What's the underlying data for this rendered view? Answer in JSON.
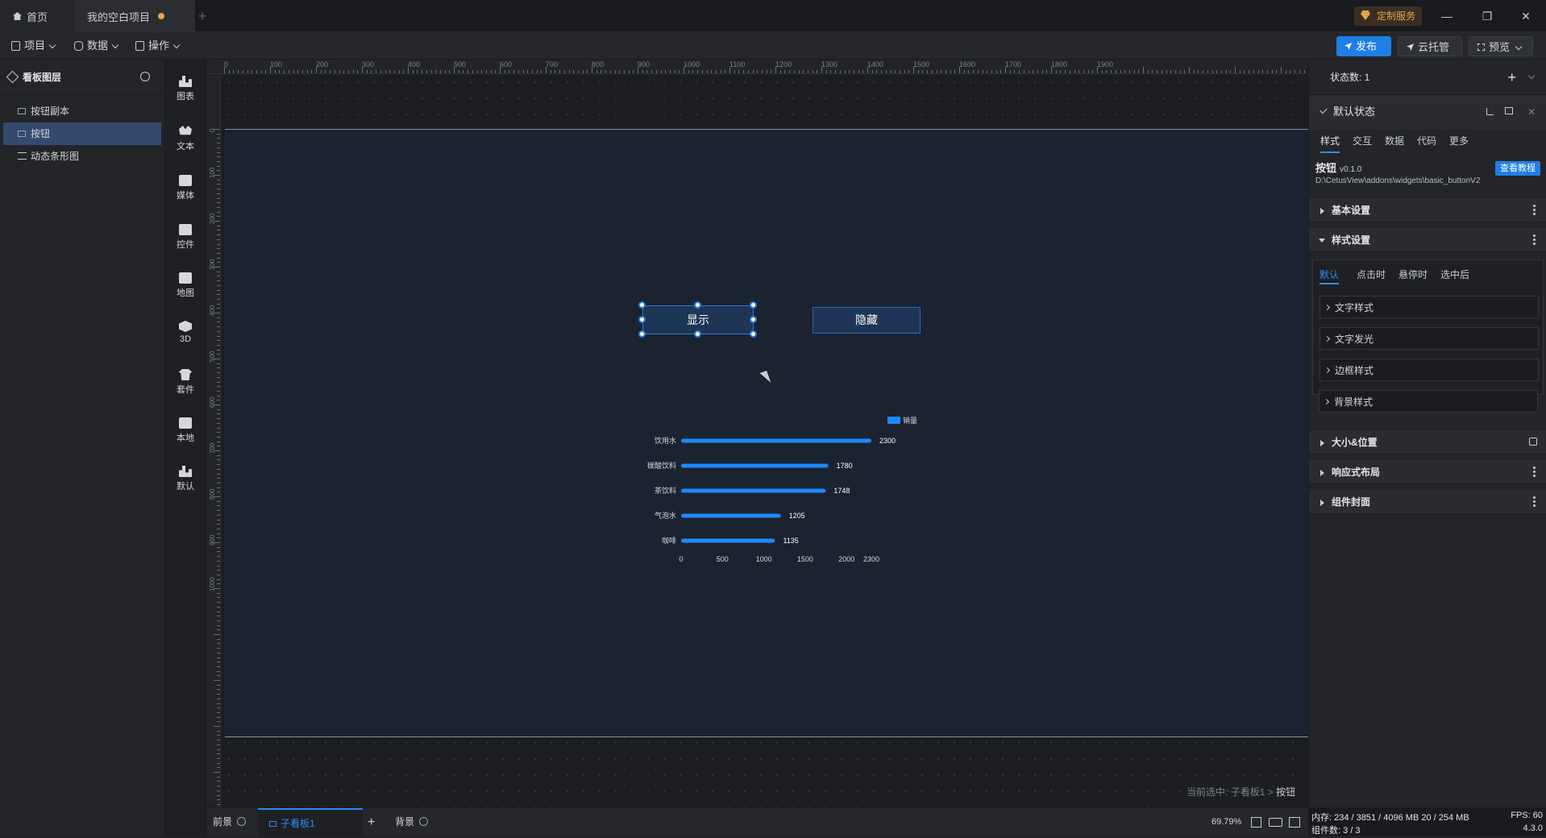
{
  "titlebar": {
    "home_tab": "首页",
    "project_tab": "我的空白项目",
    "custom_service": "定制服务"
  },
  "menubar": {
    "project": "项目",
    "data": "数据",
    "operation": "操作",
    "publish": "发布",
    "cloud": "云托管",
    "preview": "预览"
  },
  "layers": {
    "title": "看板图层",
    "items": [
      "按钮副本",
      "按钮",
      "动态条形图"
    ]
  },
  "components": [
    "图表",
    "文本",
    "媒体",
    "控件",
    "地图",
    "3D",
    "套件",
    "本地",
    "默认"
  ],
  "ruler": {
    "top_labels": [
      "0",
      "100",
      "200",
      "300",
      "400",
      "500",
      "600",
      "700",
      "800",
      "900",
      "1000",
      "1100",
      "1200",
      "1300",
      "1400",
      "1500",
      "1600",
      "1700",
      "1800",
      "1900"
    ],
    "left_labels": [
      "0",
      "100",
      "200",
      "300",
      "400",
      "500",
      "600",
      "700",
      "800",
      "900",
      "1000"
    ]
  },
  "canvas": {
    "show_button": "显示",
    "hide_button": "隐藏",
    "current_selection_prefix": "当前选中:",
    "current_selection_path": "子看板1 >",
    "current_selection_item": "按钮"
  },
  "chart_data": {
    "type": "bar",
    "orientation": "horizontal",
    "categories": [
      "饮用水",
      "碳酸饮料",
      "茶饮料",
      "气泡水",
      "咖啡"
    ],
    "series": [
      {
        "name": "销量",
        "values": [
          2300,
          1780,
          1748,
          1205,
          1135
        ]
      }
    ],
    "xticks": [
      "0",
      "500",
      "1000",
      "1500",
      "2000",
      "2300"
    ],
    "xlim": [
      0,
      2300
    ],
    "legend": "top-right",
    "grid": false,
    "color": "#1e88ff"
  },
  "bottombar": {
    "foreground": "前景",
    "sub_board": "子看板1",
    "background": "背景",
    "zoom": "69.79%"
  },
  "rightpanel": {
    "state_count": "状态数: 1",
    "default_state": "默认状态",
    "tabs": [
      "样式",
      "交互",
      "数据",
      "代码",
      "更多"
    ],
    "component_name": "按钮",
    "component_version": "v0.1.0",
    "component_path": "D:\\CetusView\\addons\\widgets\\basic_buttonV2",
    "tutorial": "查看教程",
    "basic_settings": "基本设置",
    "style_settings": "样式设置",
    "style_tabs": [
      "默认",
      "点击时",
      "悬停时",
      "选中后"
    ],
    "style_items": [
      "文字样式",
      "文字发光",
      "边框样式",
      "背景样式"
    ],
    "size_position": "大小&位置",
    "responsive": "响应式布局",
    "cover": "组件封面"
  },
  "status": {
    "memory": "内存: 234 / 3851 / 4096 MB  20 / 254 MB",
    "fps": "FPS: 60",
    "components": "组件数: 3 / 3",
    "version": "4.3.0"
  }
}
